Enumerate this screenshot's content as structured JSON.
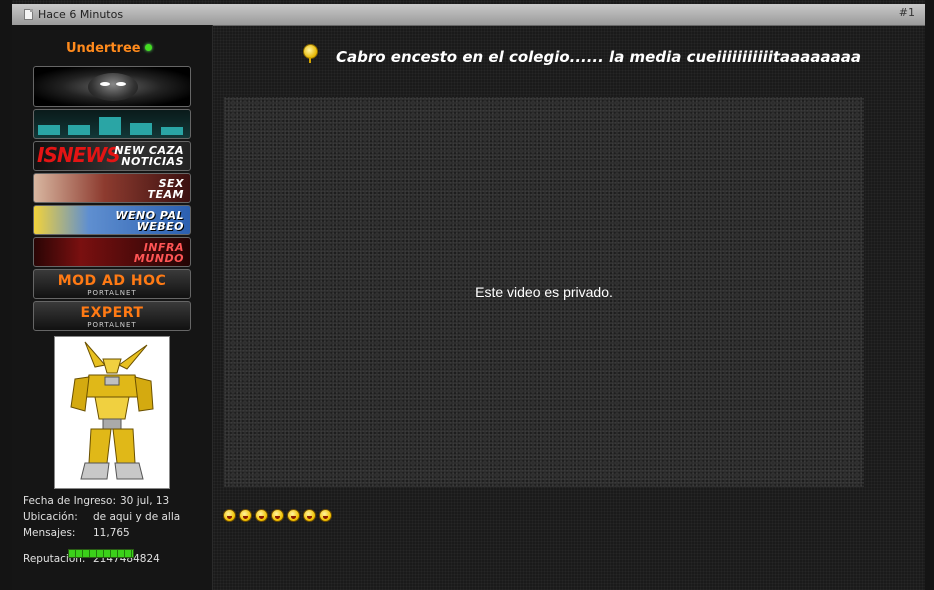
{
  "header": {
    "time_label": "Hace 6 Minutos",
    "post_number": "#1"
  },
  "user": {
    "name": "Undertree",
    "status": "online",
    "banners": {
      "b3": {
        "left_text": "ISNEWS",
        "right_text": "NEW CAZA NOTICIAS"
      },
      "b4": {
        "right_text": "SEX TEAM"
      },
      "b5": {
        "right_text": "WENO PAL WEBEO"
      },
      "b6": {
        "right_text": "INFRA MUNDO"
      },
      "b7": {
        "title": "MOD AD HOC",
        "subtitle": "PORTALNET"
      },
      "b8": {
        "title": "EXPERT",
        "subtitle": "PORTALNET"
      }
    },
    "info": {
      "fecha_label": "Fecha de Ingreso:",
      "fecha_value": "30 jul, 13",
      "ubicacion_label": "Ubicación:",
      "ubicacion_value": "de aqui y de alla",
      "mensajes_label": "Mensajes:",
      "mensajes_value": "11,765",
      "reputacion_label": "Reputación:",
      "reputacion_value": "2147484824"
    }
  },
  "post": {
    "title": "Cabro encesto en el colegio...... la media cueiiiiiiiiiiitaaaaaaaa",
    "video_message": "Este video es privado.",
    "smiley_count": 7
  },
  "colors": {
    "username": "#ff8a1c",
    "online": "#44dd22",
    "reputation": "#3bd01a"
  }
}
